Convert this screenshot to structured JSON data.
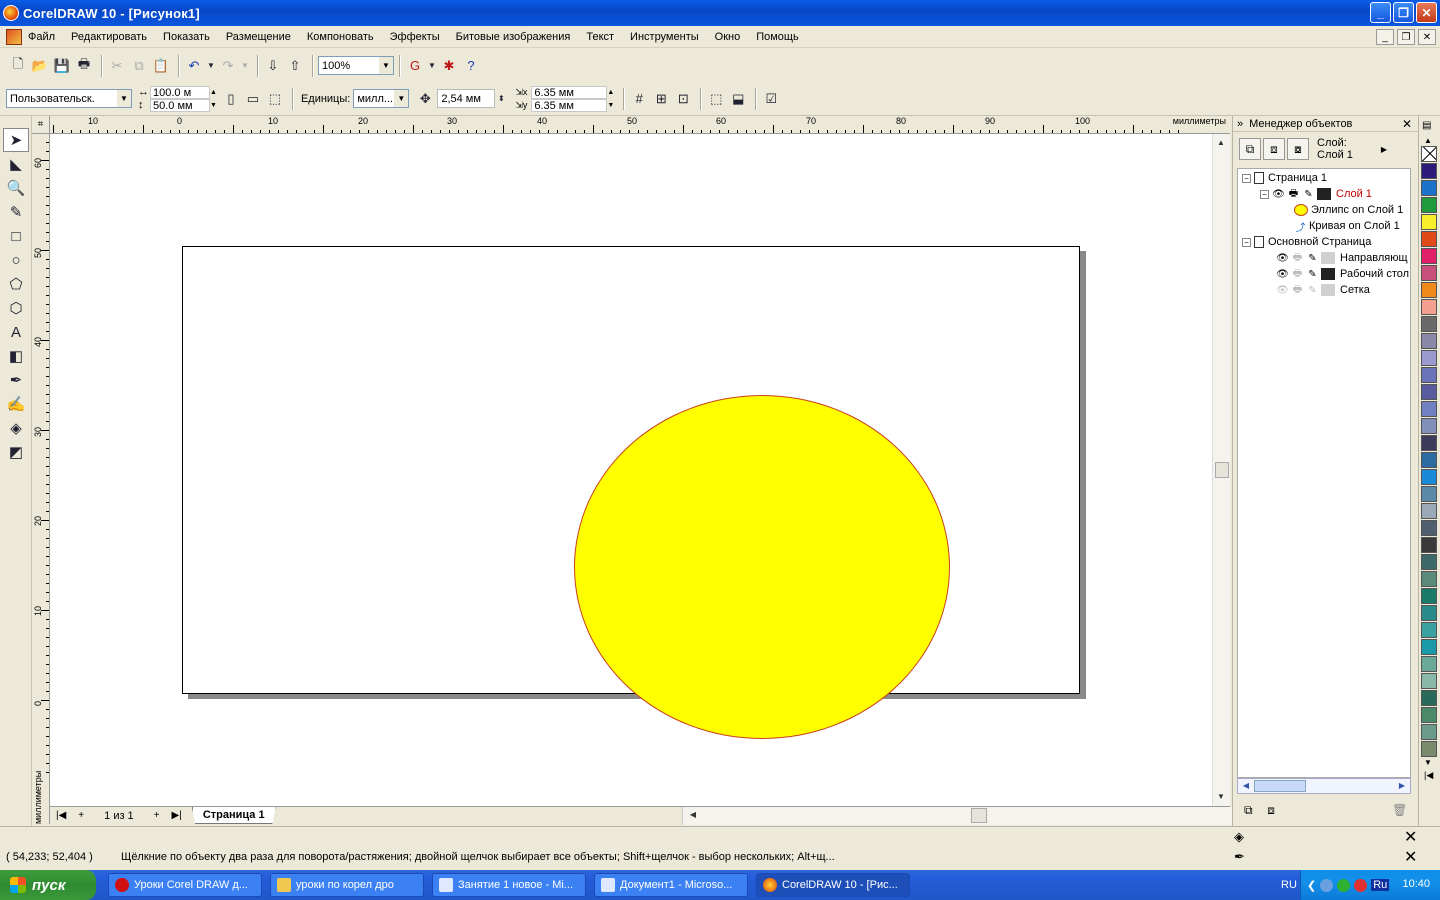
{
  "window": {
    "title": "CorelDRAW 10 - [Рисунок1]"
  },
  "menu": [
    "Файл",
    "Редактировать",
    "Показать",
    "Размещение",
    "Компоновать",
    "Эффекты",
    "Битовые изображения",
    "Текст",
    "Инструменты",
    "Окно",
    "Помощь"
  ],
  "toolbar": {
    "zoom": "100%"
  },
  "propertybar": {
    "paper_preset": "Пользовательск.",
    "width": "100.0 м",
    "height": "50.0 мм",
    "units_label": "Единицы:",
    "units_value": "милл...",
    "nudge": "2,54 мм",
    "dup_x": "6.35 мм",
    "dup_y": "6.35 мм"
  },
  "ruler": {
    "unit": "миллиметры",
    "top_labels": [
      "10",
      "0",
      "10",
      "20",
      "30",
      "40",
      "50",
      "60",
      "70",
      "80",
      "90",
      "100"
    ],
    "left_labels": [
      "60",
      "50",
      "40",
      "30",
      "20",
      "10",
      "0"
    ]
  },
  "pagebar": {
    "counter": "1 из 1",
    "tab": "Страница 1"
  },
  "object_manager": {
    "title": "Менеджер объектов",
    "layer_label": "Слой:",
    "layer_value": "Слой 1",
    "tree": {
      "page1": "Страница 1",
      "layer1": "Слой 1",
      "ellipse": "Эллипс on Слой 1",
      "curve": "Кривая on Слой 1",
      "master": "Основной Страница",
      "guides": "Направляющ",
      "desktop": "Рабочий стол",
      "grid": "Сетка"
    }
  },
  "palette": [
    "#2b1a7a",
    "#1c72c8",
    "#1f9a3c",
    "#f6ef2a",
    "#e04a18",
    "#e2206a",
    "#c8507a",
    "#f08a1a",
    "#f4a090",
    "#6a6a6a",
    "#8a8aa8",
    "#9a9ad0",
    "#6a74b8",
    "#5a5aa0",
    "#7080c0",
    "#8090b8",
    "#3c3c5a",
    "#2c6aa0",
    "#1a8ad8",
    "#5a8aa8",
    "#9aa8b8",
    "#506070",
    "#3a3a3a",
    "#3c6a6a",
    "#5a8a7a",
    "#1a7a6a",
    "#2a8a8a",
    "#3aa0a0",
    "#1a9aa8",
    "#6aa898",
    "#8ab8a8",
    "#2a6a5a",
    "#4a8a6a",
    "#6a9a8a",
    "#7a8a6a"
  ],
  "status": {
    "coords": "( 54,233; 52,404 )",
    "hint": "Щёлкние по объекту два раза для поворота/растяжения; двойной щелчок выбирает все объекты; Shift+щелчок - выбор нескольких; Alt+щ..."
  },
  "taskbar": {
    "start": "пуск",
    "tasks": [
      "Уроки Corel DRAW д...",
      "уроки по корел дро",
      "Занятие 1 новое - Mi...",
      "Документ1 - Microso...",
      "CorelDRAW 10 - [Рис..."
    ],
    "lang": "RU",
    "tray_lang": "Ru",
    "clock": "10:40"
  },
  "colors": {
    "ellipse_fill": "#ffff00",
    "ellipse_outline": "#c8401c",
    "layer_active": "#c00000"
  }
}
